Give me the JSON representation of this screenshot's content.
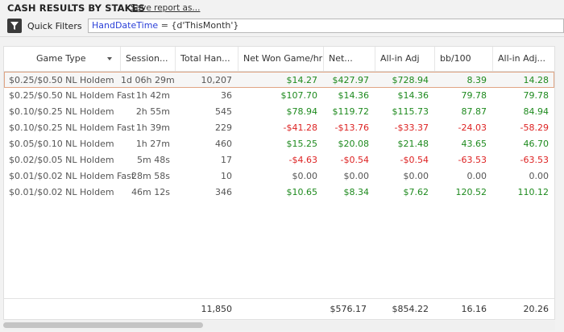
{
  "header": {
    "title": "CASH RESULTS BY STAKES",
    "save_link": "Save report as..."
  },
  "filter": {
    "button_label": "Quick Filters",
    "key": "HandDateTime",
    "operator": "=",
    "value": "{d'ThisMonth'}"
  },
  "columns": [
    {
      "label": "Game Type"
    },
    {
      "label": "Session..."
    },
    {
      "label": "Total Han..."
    },
    {
      "label": "Net Won Game/hr"
    },
    {
      "label": "Net..."
    },
    {
      "label": "All-in Adj"
    },
    {
      "label": "bb/100"
    },
    {
      "label": "All-in Adj..."
    }
  ],
  "rows": [
    {
      "game": "$0.25/$0.50 NL Holdem",
      "session": "1d 06h 29m",
      "hands": "10,207",
      "netwon_hr": "$14.27",
      "net": "$427.97",
      "allin": "$728.94",
      "bb100": "8.39",
      "allin_bb": "14.28",
      "selected": true
    },
    {
      "game": "$0.25/$0.50 NL Holdem Fast",
      "session": "1h 42m",
      "hands": "36",
      "netwon_hr": "$107.70",
      "net": "$14.36",
      "allin": "$14.36",
      "bb100": "79.78",
      "allin_bb": "79.78"
    },
    {
      "game": "$0.10/$0.25 NL Holdem",
      "session": "2h 55m",
      "hands": "545",
      "netwon_hr": "$78.94",
      "net": "$119.72",
      "allin": "$115.73",
      "bb100": "87.87",
      "allin_bb": "84.94"
    },
    {
      "game": "$0.10/$0.25 NL Holdem Fast",
      "session": "1h 39m",
      "hands": "229",
      "netwon_hr": "-$41.28",
      "net": "-$13.76",
      "allin": "-$33.37",
      "bb100": "-24.03",
      "allin_bb": "-58.29"
    },
    {
      "game": "$0.05/$0.10 NL Holdem",
      "session": "1h 27m",
      "hands": "460",
      "netwon_hr": "$15.25",
      "net": "$20.08",
      "allin": "$21.48",
      "bb100": "43.65",
      "allin_bb": "46.70"
    },
    {
      "game": "$0.02/$0.05 NL Holdem",
      "session": "5m 48s",
      "hands": "17",
      "netwon_hr": "-$4.63",
      "net": "-$0.54",
      "allin": "-$0.54",
      "bb100": "-63.53",
      "allin_bb": "-63.53"
    },
    {
      "game": "$0.01/$0.02 NL Holdem Fast",
      "session": "28m 58s",
      "hands": "10",
      "netwon_hr": "$0.00",
      "net": "$0.00",
      "allin": "$0.00",
      "bb100": "0.00",
      "allin_bb": "0.00"
    },
    {
      "game": "$0.01/$0.02 NL Holdem",
      "session": "46m 12s",
      "hands": "346",
      "netwon_hr": "$10.65",
      "net": "$8.34",
      "allin": "$7.62",
      "bb100": "120.52",
      "allin_bb": "110.12"
    }
  ],
  "totals": {
    "hands": "11,850",
    "net": "$576.17",
    "allin": "$854.22",
    "bb100": "16.16",
    "allin_bb": "20.26"
  },
  "colors": {
    "positive": "#1e8a1e",
    "negative": "#dd2222",
    "filter_key": "#2a3fd8",
    "selected_border": "#e0a584"
  },
  "icons": {
    "filter": "funnel-icon",
    "sort": "sort-down-icon"
  }
}
